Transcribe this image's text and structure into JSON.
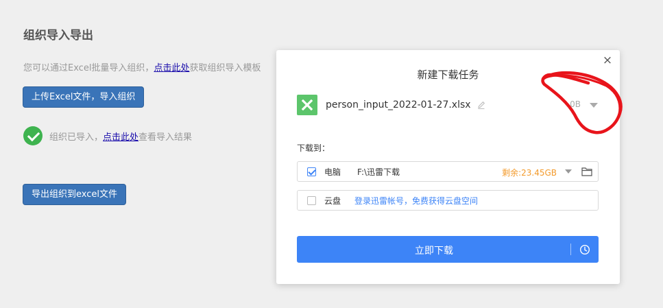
{
  "page": {
    "title": "组织导入导出",
    "desc_prefix": "您可以通过Excel批量导入组织，",
    "desc_link": "点击此处",
    "desc_suffix": "获取组织导入模板",
    "upload_button": "上传Excel文件，导入组织",
    "status_prefix": "组织已导入，",
    "status_link": "点击此处",
    "status_suffix": "查看导入结果",
    "export_button": "导出组织到excel文件"
  },
  "dialog": {
    "title": "新建下载任务",
    "close_glyph": "×",
    "file_name": "person_input_2022-01-27.xlsx",
    "file_size": "0B",
    "save_to_label": "下载到：",
    "pc": {
      "checked": true,
      "label": "电脑",
      "path": "F:\\迅雷下载",
      "free_space": "剩余:23.45GB"
    },
    "cloud": {
      "checked": false,
      "label": "云盘",
      "link": "登录迅雷帐号，免费获得云盘空间"
    },
    "download_button": "立即下载"
  },
  "icons": {
    "file": "excel-file-icon",
    "edit": "pencil-icon",
    "folder": "folder-icon",
    "schedule": "clock-icon",
    "success": "check-circle-icon"
  },
  "colors": {
    "primary_blue": "#3d84f7",
    "page_button_blue": "#3a74b8",
    "excel_green": "#5cc56b",
    "success_green": "#3eb34f",
    "free_space_orange": "#f39a2b",
    "annotation_red": "#e8141b"
  }
}
